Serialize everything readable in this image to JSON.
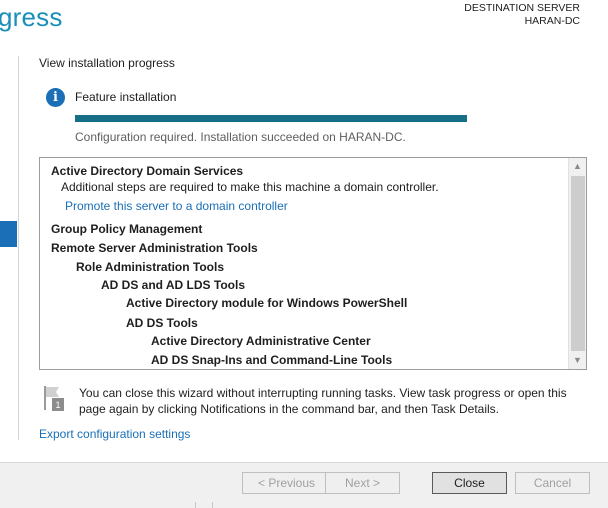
{
  "header": {
    "title": "gress",
    "destination_label": "DESTINATION SERVER",
    "destination_server": "HARAN-DC"
  },
  "main": {
    "heading": "View installation progress",
    "feature_label": "Feature installation",
    "progress_fraction": 1.0,
    "status_text": "Configuration required. Installation succeeded on HARAN-DC.",
    "results": [
      {
        "text": "Active Directory Domain Services",
        "style": "bold",
        "indent": 0
      },
      {
        "text": "Additional steps are required to make this machine a domain controller.",
        "style": "plain",
        "indent": 1
      },
      {
        "text": "Promote this server to a domain controller",
        "style": "link",
        "indent": 1
      },
      {
        "text": "Group Policy Management",
        "style": "bold",
        "indent": 0
      },
      {
        "text": "Remote Server Administration Tools",
        "style": "bold",
        "indent": 0
      },
      {
        "text": "Role Administration Tools",
        "style": "bold",
        "indent": 1
      },
      {
        "text": "AD DS and AD LDS Tools",
        "style": "bold",
        "indent": 2
      },
      {
        "text": "Active Directory module for Windows PowerShell",
        "style": "bold",
        "indent": 3
      },
      {
        "text": "AD DS Tools",
        "style": "bold",
        "indent": 3
      },
      {
        "text": "Active Directory Administrative Center",
        "style": "bold",
        "indent": 4
      },
      {
        "text": "AD DS Snap-Ins and Command-Line Tools",
        "style": "bold",
        "indent": 4
      }
    ],
    "note_text": "You can close this wizard without interrupting running tasks. View task progress or open this page again by clicking Notifications in the command bar, and then Task Details.",
    "note_badge": "1",
    "export_link": "Export configuration settings"
  },
  "footer": {
    "previous_label": "< Previous",
    "next_label": "Next >",
    "close_label": "Close",
    "cancel_label": "Cancel"
  },
  "colors": {
    "accent": "#1a8fb8",
    "progress": "#176f87",
    "link": "#1a6fb6"
  }
}
